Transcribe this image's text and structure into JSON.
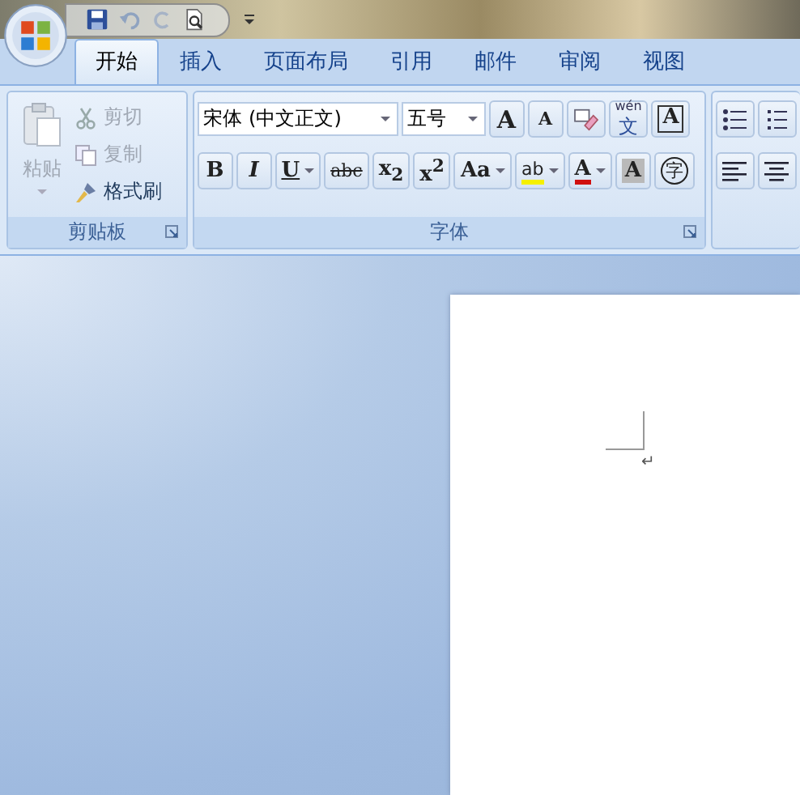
{
  "tabs": [
    {
      "label": "开始",
      "selected": true
    },
    {
      "label": "插入",
      "selected": false
    },
    {
      "label": "页面布局",
      "selected": false
    },
    {
      "label": "引用",
      "selected": false
    },
    {
      "label": "邮件",
      "selected": false
    },
    {
      "label": "审阅",
      "selected": false
    },
    {
      "label": "视图",
      "selected": false
    }
  ],
  "clipboard": {
    "paste": {
      "label": "粘贴",
      "disabled": true
    },
    "items": [
      {
        "label": "剪切",
        "kind": "cut",
        "disabled": true
      },
      {
        "label": "复制",
        "kind": "copy",
        "disabled": true
      },
      {
        "label": "格式刷",
        "kind": "brush",
        "disabled": false
      }
    ],
    "group_label": "剪贴板"
  },
  "font": {
    "font_name": "宋体 (中文正文)",
    "font_size": "五号",
    "row1": [
      {
        "kind": "grow",
        "glyph": "A"
      },
      {
        "kind": "shrink",
        "glyph": "A"
      },
      {
        "kind": "clear"
      },
      {
        "kind": "phonetic",
        "glyph": "文",
        "ruby": "wén"
      },
      {
        "kind": "border",
        "glyph": "A"
      }
    ],
    "row2": [
      {
        "kind": "bold",
        "glyph": "B"
      },
      {
        "kind": "italic",
        "glyph": "I"
      },
      {
        "kind": "underline",
        "glyph": "U"
      },
      {
        "kind": "strike",
        "glyph": "abc"
      },
      {
        "kind": "sub",
        "glyph": "x$_{2}$"
      },
      {
        "kind": "sup",
        "glyph": "x$^{2}$"
      },
      {
        "kind": "case",
        "glyph": "Aa"
      },
      {
        "kind": "highlight",
        "glyph": "ab"
      },
      {
        "kind": "color",
        "glyph": "A"
      },
      {
        "kind": "shading",
        "glyph": "A"
      },
      {
        "kind": "enclose",
        "glyph": "字"
      }
    ],
    "group_label": "字体"
  },
  "document": {
    "paragraph_mark": "↵"
  }
}
